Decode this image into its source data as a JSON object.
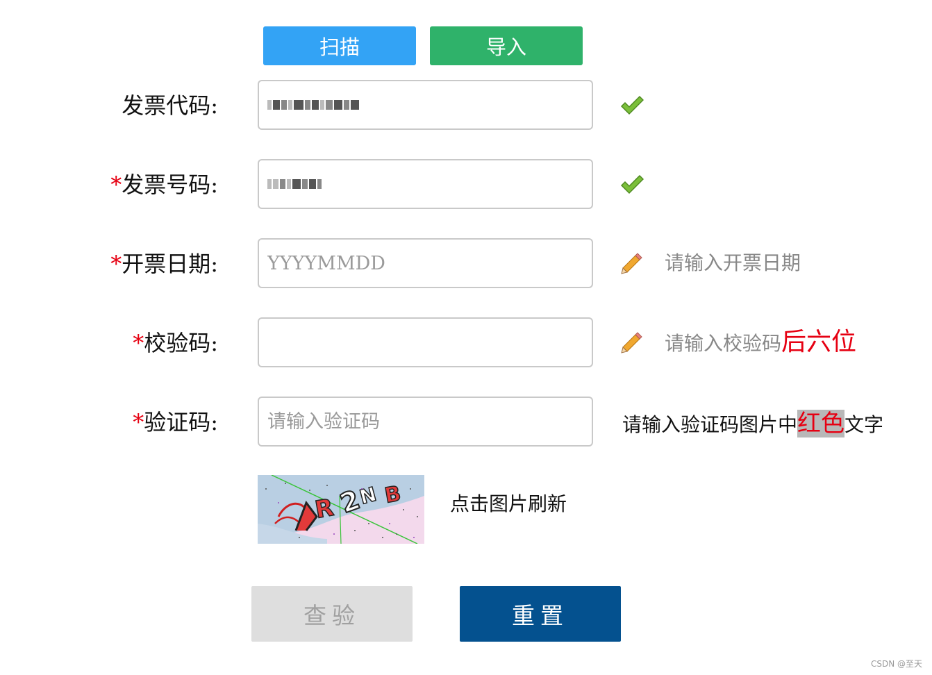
{
  "toolbar": {
    "scan_label": "扫描",
    "import_label": "导入"
  },
  "form": {
    "invoice_code": {
      "label": "发票代码:",
      "required": false,
      "status": "valid"
    },
    "invoice_number": {
      "label": "发票号码:",
      "required": true,
      "status": "valid"
    },
    "invoice_date": {
      "label": "开票日期:",
      "required": true,
      "placeholder": "YYYYMMDD",
      "hint": "请输入开票日期"
    },
    "check_code": {
      "label": "校验码:",
      "required": true,
      "hint_prefix": "请输入校验码",
      "hint_emphasis": "后六位"
    },
    "verify_code": {
      "label": "验证码:",
      "required": true,
      "placeholder": "请输入验证码",
      "hint_prefix": "请输入验证码图片中",
      "hint_emphasis": "红色",
      "hint_suffix": "文字"
    },
    "required_mark": "*"
  },
  "captcha": {
    "refresh_text": "点击图片刷新"
  },
  "actions": {
    "check_label": "查验",
    "reset_label": "重置"
  },
  "footer": {
    "watermark": "CSDN @至天"
  },
  "colors": {
    "scan": "#33a3f5",
    "import": "#2fb26a",
    "reset": "#04518f",
    "check_disabled": "#dedede",
    "required": "#e60012"
  },
  "icons": {
    "valid": "checkmark-icon",
    "pending": "pencil-icon"
  }
}
